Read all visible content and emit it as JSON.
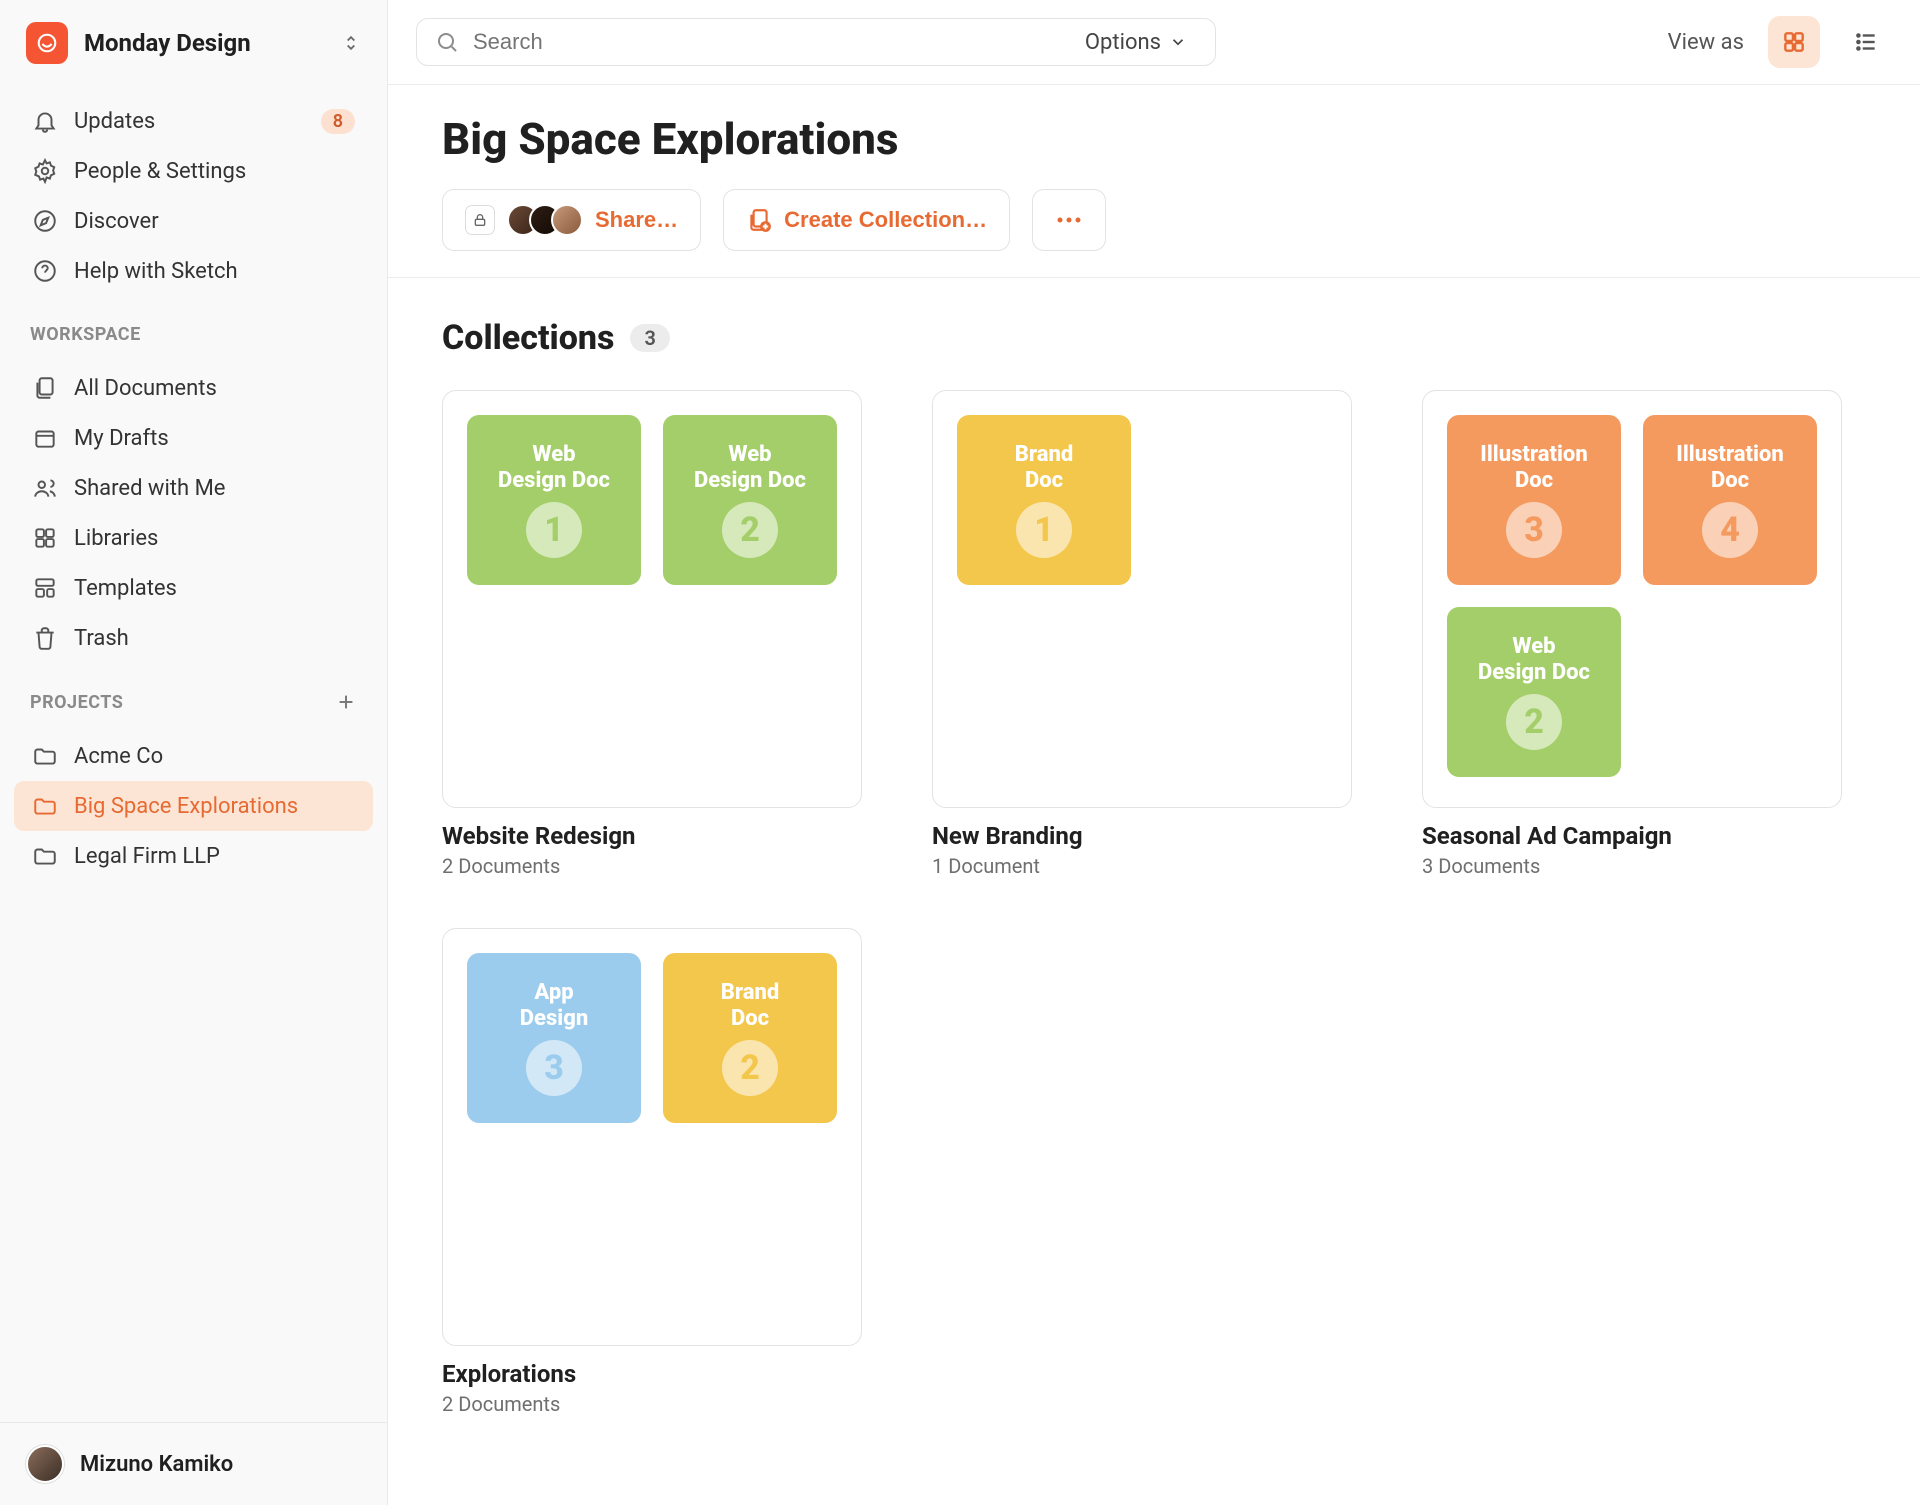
{
  "workspace": {
    "name": "Monday Design"
  },
  "sidebar": {
    "nav": [
      {
        "label": "Updates",
        "icon": "bell",
        "badge": "8"
      },
      {
        "label": "People & Settings",
        "icon": "gear"
      },
      {
        "label": "Discover",
        "icon": "compass"
      },
      {
        "label": "Help with Sketch",
        "icon": "help"
      }
    ],
    "workspace_heading": "WORKSPACE",
    "workspace_items": [
      {
        "label": "All Documents",
        "icon": "docs"
      },
      {
        "label": "My Drafts",
        "icon": "draft"
      },
      {
        "label": "Shared with Me",
        "icon": "shared"
      },
      {
        "label": "Libraries",
        "icon": "libraries"
      },
      {
        "label": "Templates",
        "icon": "templates"
      },
      {
        "label": "Trash",
        "icon": "trash"
      }
    ],
    "projects_heading": "PROJECTS",
    "projects": [
      {
        "label": "Acme Co",
        "active": false
      },
      {
        "label": "Big Space Explorations",
        "active": true
      },
      {
        "label": "Legal Firm LLP",
        "active": false
      }
    ]
  },
  "user": {
    "name": "Mizuno Kamiko"
  },
  "topbar": {
    "search_placeholder": "Search",
    "options_label": "Options",
    "viewas_label": "View as"
  },
  "page": {
    "title": "Big Space Explorations",
    "share_label": "Share…",
    "create_collection_label": "Create Collection…"
  },
  "collections": {
    "heading": "Collections",
    "count": "3",
    "items": [
      {
        "title": "Website Redesign",
        "subtitle": "2 Documents",
        "tiles": [
          {
            "label": "Web\nDesign Doc",
            "num": "1",
            "color": "green"
          },
          {
            "label": "Web\nDesign Doc",
            "num": "2",
            "color": "green"
          }
        ]
      },
      {
        "title": "New Branding",
        "subtitle": "1 Document",
        "tiles": [
          {
            "label": "Brand\nDoc",
            "num": "1",
            "color": "yellow"
          }
        ]
      },
      {
        "title": "Seasonal Ad Campaign",
        "subtitle": "3 Documents",
        "tiles": [
          {
            "label": "Illustration\nDoc",
            "num": "3",
            "color": "orange"
          },
          {
            "label": "Illustration\nDoc",
            "num": "4",
            "color": "orange"
          },
          {
            "label": "Web\nDesign Doc",
            "num": "2",
            "color": "green"
          }
        ]
      },
      {
        "title": "Explorations",
        "subtitle": "2 Documents",
        "tiles": [
          {
            "label": "App\nDesign",
            "num": "3",
            "color": "blue"
          },
          {
            "label": "Brand\nDoc",
            "num": "2",
            "color": "yellow"
          }
        ]
      }
    ]
  }
}
